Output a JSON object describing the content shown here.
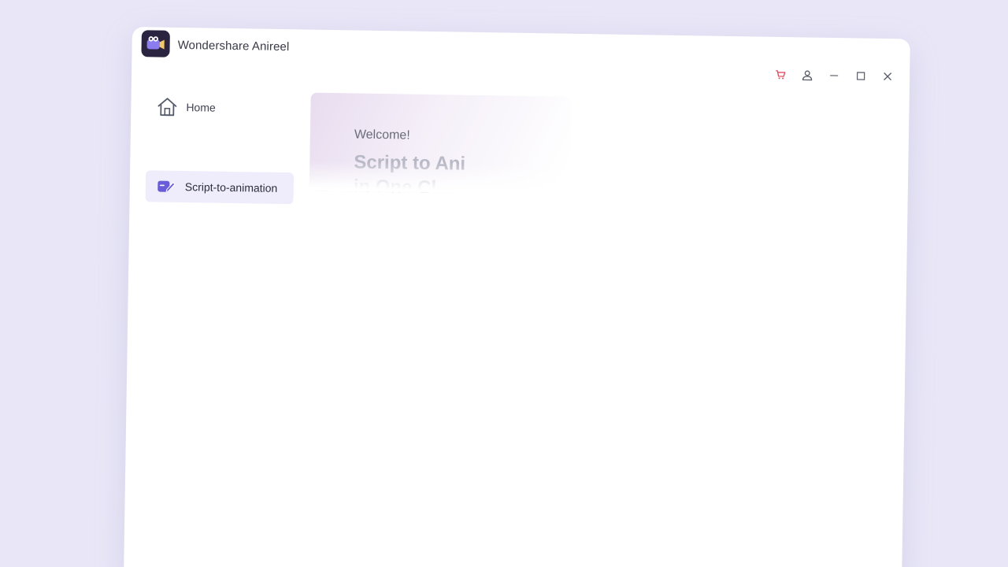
{
  "window": {
    "title": "Wondershare Anireel",
    "controls": {
      "cart": "cart-icon",
      "account": "user-icon",
      "minimize": "minimize-icon",
      "maximize": "maximize-icon",
      "close": "close-icon"
    }
  },
  "sidebar": {
    "items": [
      {
        "label": "Home",
        "icon": "home-icon",
        "selected": false
      },
      {
        "label": "Script-to-animation",
        "icon": "script-animation-icon",
        "selected": true
      }
    ]
  },
  "hero": {
    "welcome": "Welcome!",
    "headline": "Script to Ani\nin One Cl"
  },
  "colors": {
    "background": "#e9e7f7",
    "accent": "#6a5bd9",
    "cart_red": "#e0475b",
    "selected_nav": "#efedfb"
  }
}
